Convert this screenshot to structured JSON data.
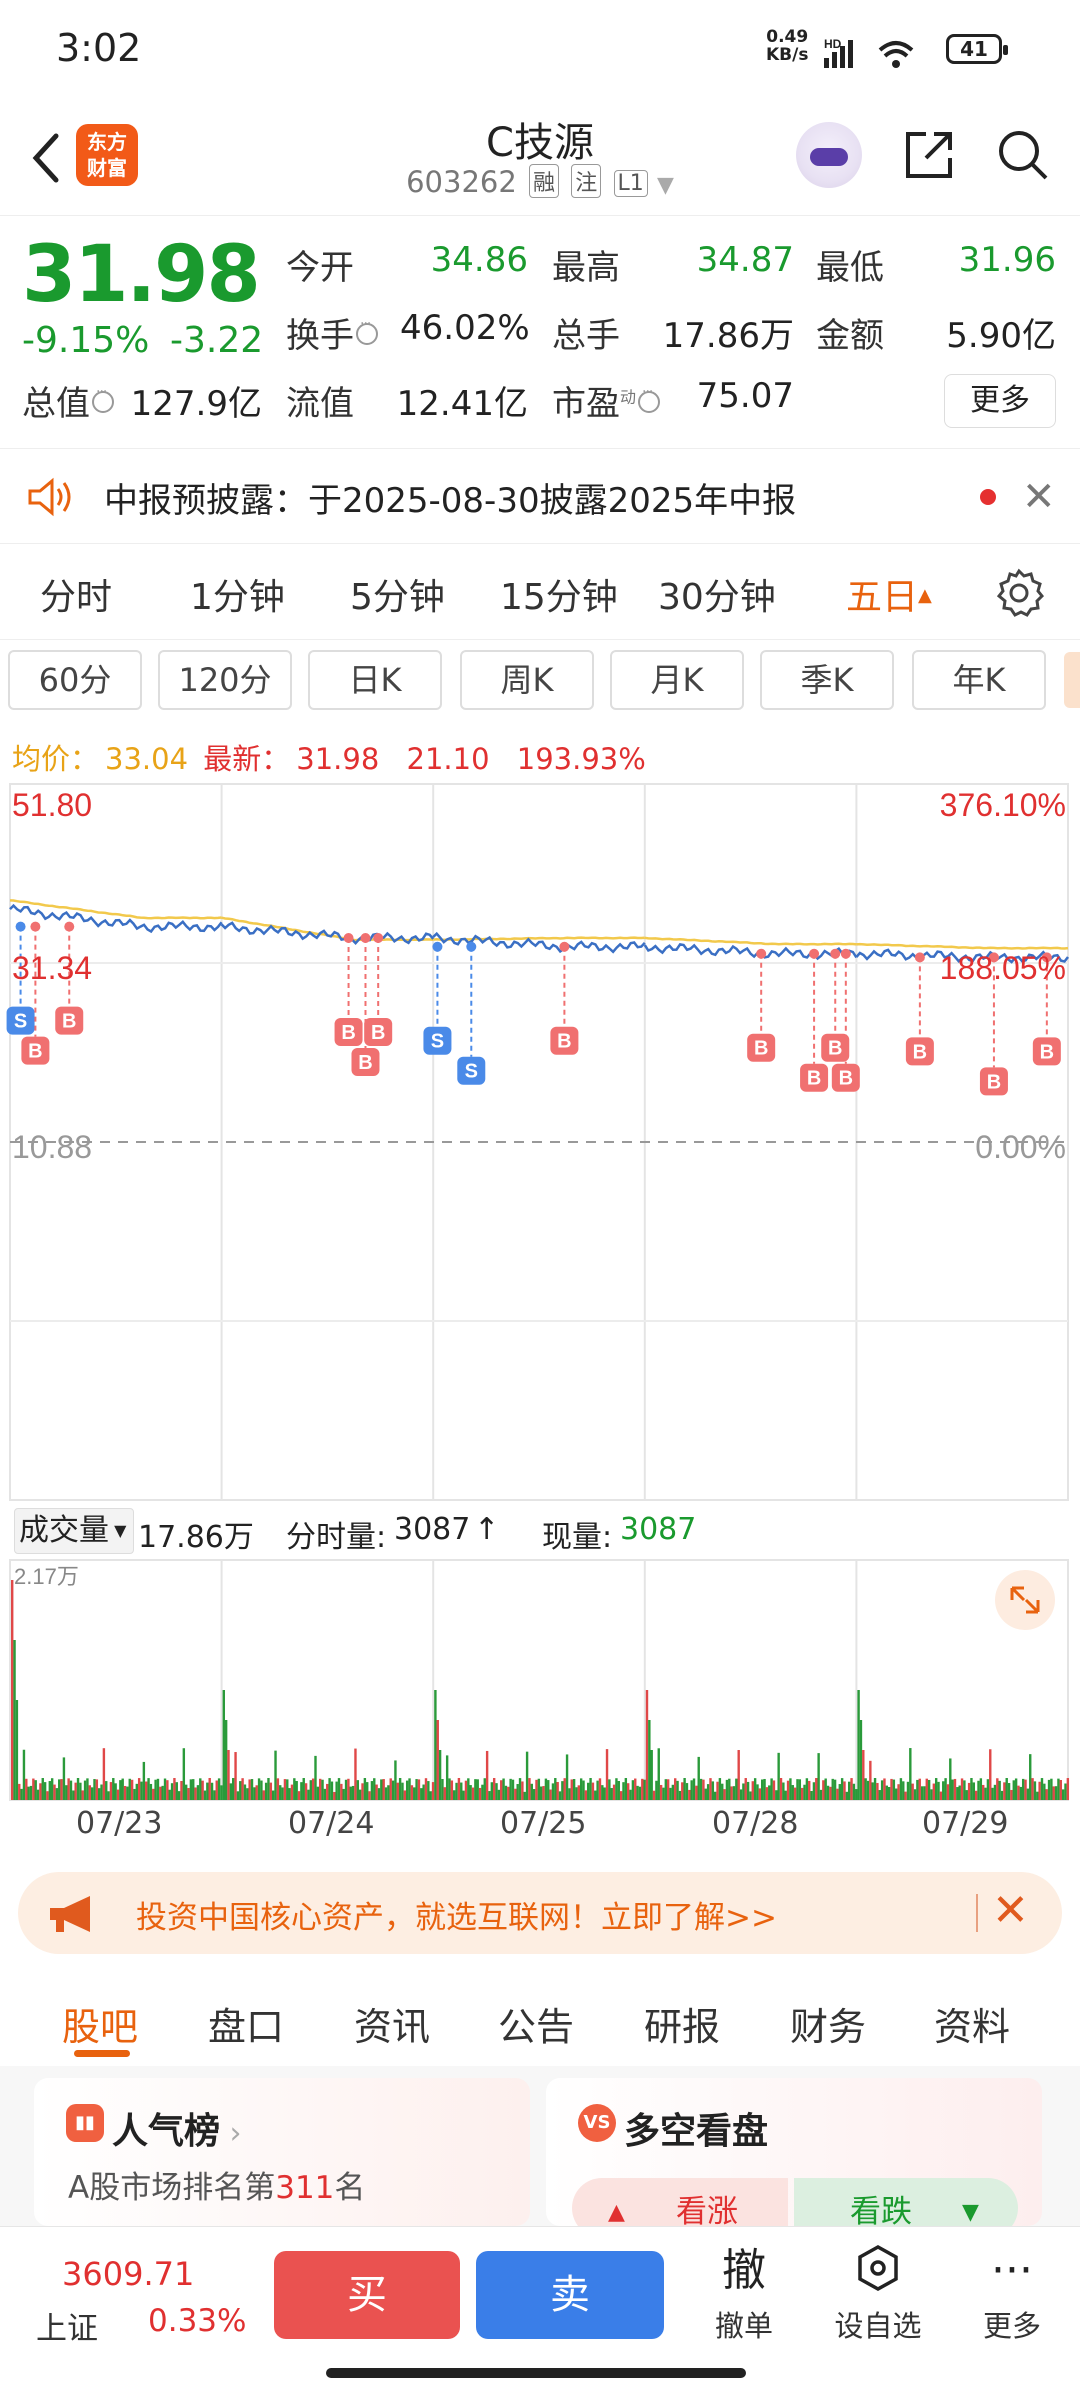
{
  "status_bar": {
    "time": "3:02",
    "net_speed": "0.49",
    "net_unit": "KB/s",
    "hd": "HD",
    "battery": "41"
  },
  "header": {
    "logo_line1": "东方",
    "logo_line2": "财富",
    "title": "C技源",
    "code": "603262",
    "tags": [
      "融",
      "注",
      "L1"
    ]
  },
  "quote": {
    "price": "31.98",
    "change_pct": "-9.15%",
    "change": "-3.22",
    "fields": [
      {
        "label": "今开",
        "value": "34.86"
      },
      {
        "label": "最高",
        "value": "34.87"
      },
      {
        "label": "最低",
        "value": "31.96"
      },
      {
        "label": "换手",
        "value": "46.02%"
      },
      {
        "label": "总手",
        "value": "17.86万"
      },
      {
        "label": "金额",
        "value": "5.90亿"
      },
      {
        "label": "总值",
        "value": "127.9亿"
      },
      {
        "label": "流值",
        "value": "12.41亿"
      },
      {
        "label": "市盈",
        "value": "75.07"
      }
    ],
    "pe_sup": "动",
    "more": "更多"
  },
  "notice": {
    "text": "中报预披露：于2025-08-30披露2025年中报"
  },
  "period_tabs": [
    "分时",
    "1分钟",
    "5分钟",
    "15分钟",
    "30分钟",
    "五日"
  ],
  "period_active_arrow": "▲",
  "k_tabs": [
    "60分",
    "120分",
    "日K",
    "周K",
    "月K",
    "季K",
    "年K"
  ],
  "avg_bar": {
    "avg_label": "均价：",
    "avg_value": "33.04",
    "latest_label": "最新：",
    "latest_value": "31.98",
    "change": "21.10",
    "change_pct": "193.93%"
  },
  "chart_data": {
    "type": "line",
    "title": "",
    "y_left_ticks": [
      "51.80",
      "31.34",
      "10.88"
    ],
    "y_right_ticks": [
      "376.10%",
      "188.05%",
      "0.00%"
    ],
    "ylim": [
      10.88,
      51.8
    ],
    "x": [
      "07/23",
      "07/24",
      "07/25",
      "07/28",
      "07/29"
    ],
    "series": [
      {
        "values": [
          35.5,
          34.2,
          33.2,
          32.4,
          31.98
        ]
      },
      {
        "values": [
          36.5,
          34.0,
          34.2,
          33.5,
          33.04
        ]
      }
    ],
    "markers": {
      "buy": "B",
      "sell": "S"
    },
    "colors": {
      "price": "#3a6fc4",
      "avg": "#f2c94c",
      "buy": "#f07070",
      "sell": "#4a8ae8"
    }
  },
  "volume": {
    "label": "成交量",
    "total": "17.86万",
    "minute_label": "分时量:",
    "minute_value": "3087",
    "minute_arrow": "↑",
    "current_label": "现量:",
    "current_value": "3087",
    "max": "2.17万"
  },
  "ad": {
    "text": "投资中国核心资产，就选互联网！立即了解>>"
  },
  "bottom_tabs": [
    "股吧",
    "盘口",
    "资讯",
    "公告",
    "研报",
    "财务",
    "资料"
  ],
  "cards": {
    "popularity": {
      "title": "人气榜",
      "sub_prefix": "A股市场排名第",
      "rank": "311",
      "sub_suffix": "名"
    },
    "sentiment": {
      "title": "多空看盘",
      "bull": "看涨",
      "bear": "看跌"
    }
  },
  "bottom_bar": {
    "index_value": "3609.71",
    "index_name": "上证",
    "index_pct": "0.33%",
    "buy": "买",
    "sell": "卖",
    "cancel_glyph": "撤",
    "cancel": "撤单",
    "watch": "设自选",
    "more": "更多"
  }
}
